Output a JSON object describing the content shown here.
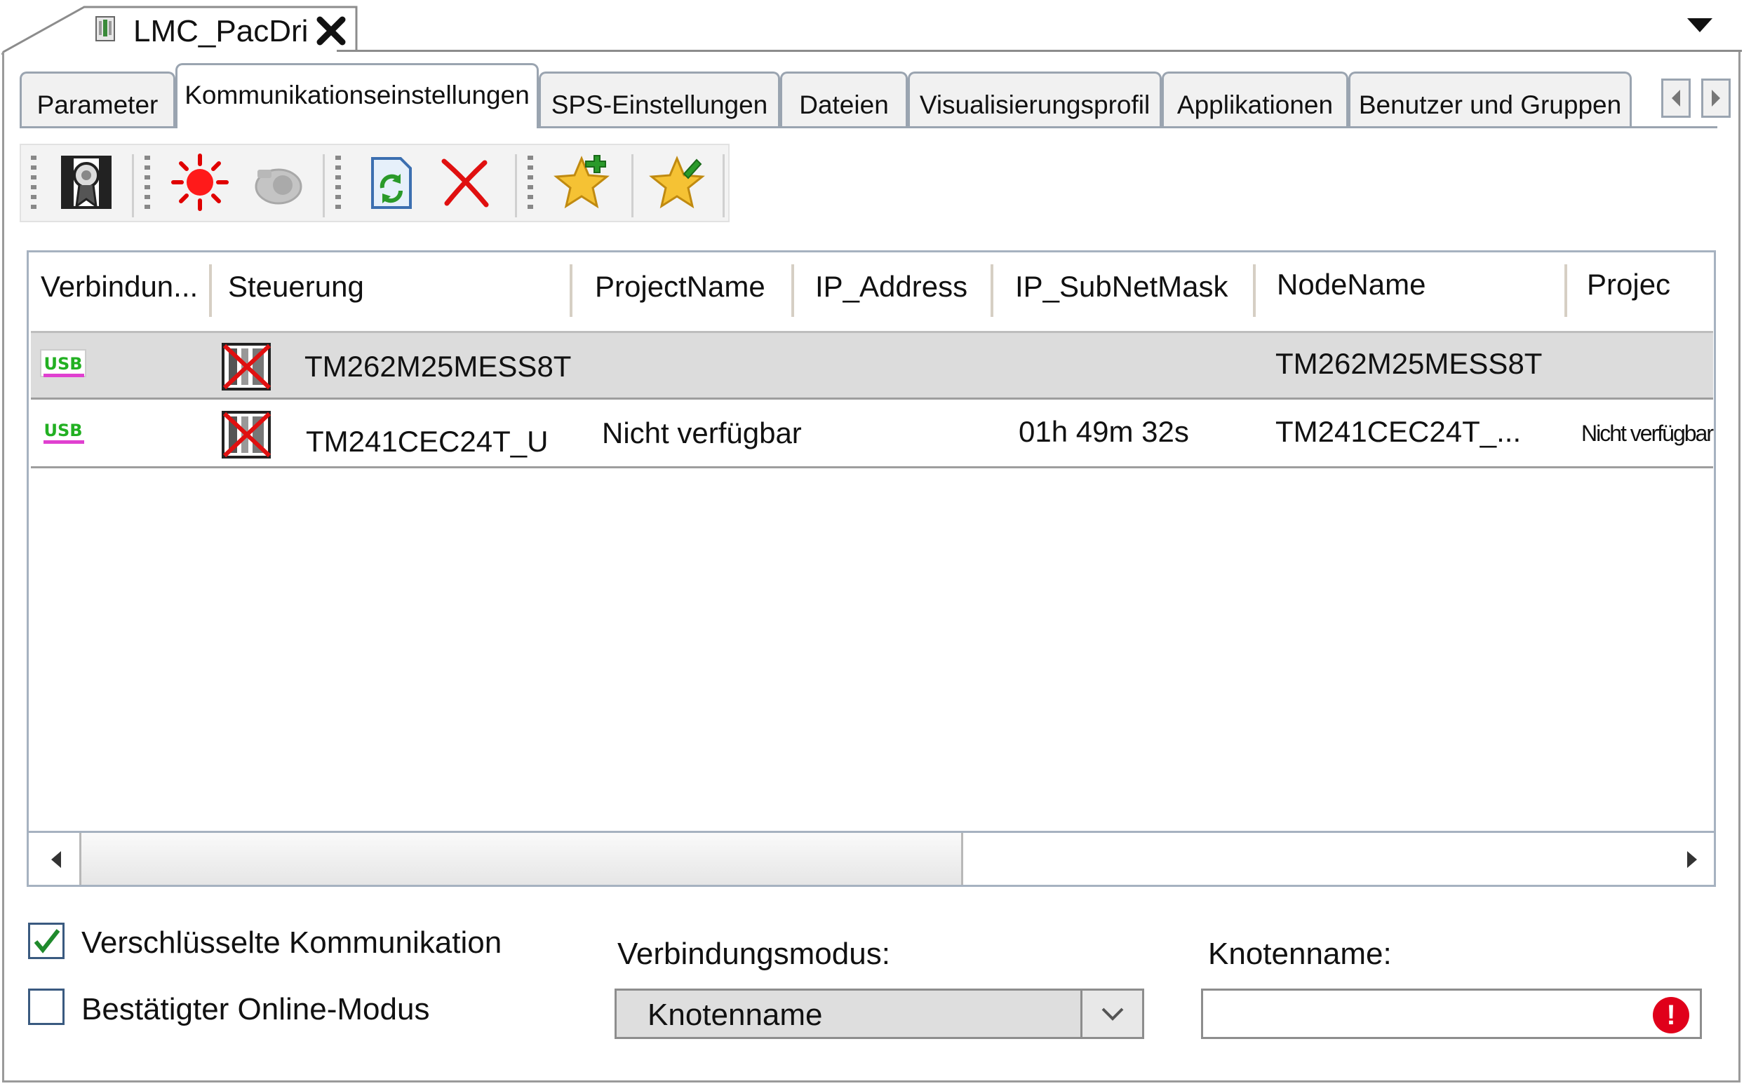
{
  "document_tab": {
    "title": "LMC_PacDri",
    "icon": "device-file-icon"
  },
  "tabs": [
    {
      "label": "Parameter",
      "active": false
    },
    {
      "label": "Kommunikationseinstellungen",
      "active": true
    },
    {
      "label": "SPS-Einstellungen",
      "active": false
    },
    {
      "label": "Dateien",
      "active": false
    },
    {
      "label": "Visualisierungsprofil",
      "active": false
    },
    {
      "label": "Applikationen",
      "active": false
    },
    {
      "label": "Benutzer und Gruppen",
      "active": false
    }
  ],
  "toolbar": {
    "icons": [
      "certificate-icon",
      "red-star-burst-icon",
      "gray-camera-icon",
      "refresh-file-icon",
      "red-x-icon",
      "star-add-icon",
      "star-edit-icon"
    ]
  },
  "table": {
    "columns": [
      "Verbindun...",
      "Steuerung",
      "ProjectName",
      "IP_Address",
      "IP_SubNetMask",
      "NodeName",
      "Projec"
    ],
    "rows": [
      {
        "connection_icon": "usb-icon",
        "controller_icon": "controller-offline-icon",
        "steuerung": "TM262M25MESS8T",
        "project_name": "",
        "ip_address": "",
        "ip_subnetmask": "",
        "node_name": "TM262M25MESS8T",
        "projec": "",
        "selected": true
      },
      {
        "connection_icon": "usb-icon",
        "controller_icon": "controller-offline-icon",
        "steuerung": "TM241CEC24T_U",
        "project_name": "Nicht verfügbar",
        "ip_address": "",
        "ip_subnetmask": "01h 49m 32s",
        "node_name": "TM241CEC24T_...",
        "projec": "Nicht verfügbar",
        "selected": false
      }
    ]
  },
  "options": {
    "encrypted": {
      "label": "Verschlüsselte Kommunikation",
      "checked": true
    },
    "confirmed_online": {
      "label": "Bestätigter Online-Modus",
      "checked": false
    }
  },
  "connection_mode": {
    "label": "Verbindungsmodus:",
    "value": "Knotenname"
  },
  "node_name_field": {
    "label": "Knotenname:",
    "value": ""
  },
  "colors": {
    "tab_border": "#9aa4b0",
    "selected_row": "#dcdcdc",
    "error": "#e0001a",
    "check": "#1f8a2c"
  }
}
